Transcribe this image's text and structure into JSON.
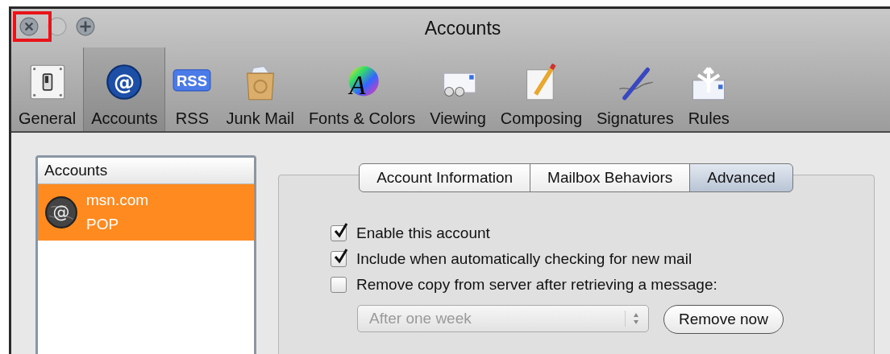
{
  "window": {
    "title": "Accounts"
  },
  "toolbar": [
    {
      "label": "General",
      "selected": false
    },
    {
      "label": "Accounts",
      "selected": true,
      "glyph": "@"
    },
    {
      "label": "RSS",
      "selected": false,
      "glyph": "RSS"
    },
    {
      "label": "Junk Mail",
      "selected": false
    },
    {
      "label": "Fonts & Colors",
      "selected": false,
      "glyph": "A"
    },
    {
      "label": "Viewing",
      "selected": false
    },
    {
      "label": "Composing",
      "selected": false
    },
    {
      "label": "Signatures",
      "selected": false
    },
    {
      "label": "Rules",
      "selected": false
    }
  ],
  "accounts_list": {
    "header": "Accounts",
    "items": [
      {
        "name": "msn.com",
        "type": "POP",
        "selected": true,
        "glyph": "@"
      }
    ]
  },
  "tabs": [
    {
      "label": "Account Information",
      "selected": false
    },
    {
      "label": "Mailbox Behaviors",
      "selected": false
    },
    {
      "label": "Advanced",
      "selected": true
    }
  ],
  "options": [
    {
      "label": "Enable this account",
      "checked": true
    },
    {
      "label": "Include when automatically checking for new mail",
      "checked": true
    },
    {
      "label": "Remove copy from server after retrieving a message:",
      "checked": false
    }
  ],
  "remove_after": {
    "value": "After one week",
    "disabled": true
  },
  "remove_button": {
    "label": "Remove now"
  }
}
